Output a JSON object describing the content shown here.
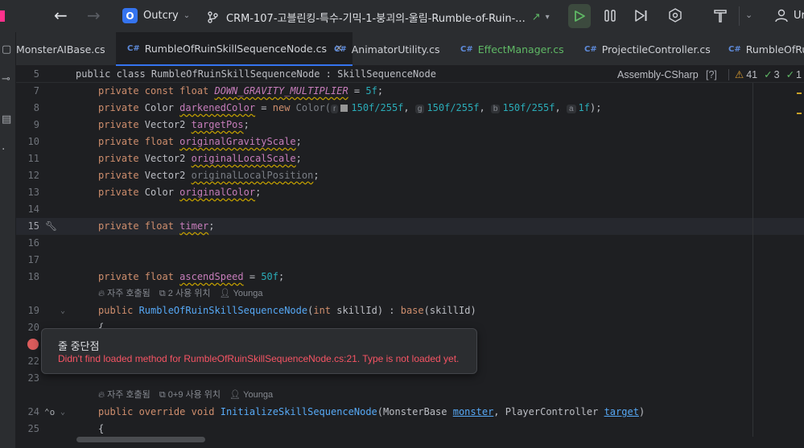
{
  "titlebar": {
    "project_initial": "O",
    "project_name": "Outcry",
    "branch": "CRM-107-고블린킹-특수-기믹-1-붕괴의-울림-Rumble-of-Ruin-...",
    "branch_arrow": "↗",
    "branch_more": "▾",
    "account_initial": "Ur"
  },
  "tabs": [
    {
      "label": "MonsterAIBase.cs",
      "badge": ""
    },
    {
      "label": "RumbleOfRuinSkillSequenceNode.cs",
      "badge": "C#"
    },
    {
      "label": "AnimatorUtility.cs",
      "badge": "C#"
    },
    {
      "label": "EffectManager.cs",
      "badge": "C#"
    },
    {
      "label": "ProjectileController.cs",
      "badge": "C#"
    },
    {
      "label": "RumbleOfRu",
      "badge": "C#"
    }
  ],
  "header": {
    "line_number": "5",
    "sticky_code": "public class RumbleOfRuinSkillSequenceNode : SkillSequenceNode",
    "assembly": "Assembly-CSharp",
    "warnings": "41",
    "checks": "3",
    "extra": "1"
  },
  "lines": [
    {
      "n": "7"
    },
    {
      "n": "8"
    },
    {
      "n": "9"
    },
    {
      "n": "10"
    },
    {
      "n": "11"
    },
    {
      "n": "12"
    },
    {
      "n": "13"
    },
    {
      "n": "14"
    },
    {
      "n": "15"
    },
    {
      "n": "16"
    },
    {
      "n": "17"
    },
    {
      "n": "18"
    },
    {
      "n": "19"
    },
    {
      "n": "20"
    },
    {
      "n": "22"
    },
    {
      "n": "23"
    },
    {
      "n": "24"
    },
    {
      "n": "25"
    }
  ],
  "code": {
    "l7": {
      "kw": "private const float ",
      "name": "DOWN_GRAVITY_MULTIPLIER",
      "rest": " = ",
      "val": "5f",
      "end": ";"
    },
    "l8": {
      "kw": "private",
      "type": " Color ",
      "name": "darkenedColor",
      "eq": " = ",
      "new": "new",
      "ctor": " Color(",
      "h_r": "r",
      "v_r": "150f/255f",
      "h_g": "g",
      "v_g": "150f/255f",
      "h_b": "b",
      "v_b": "150f/255f",
      "h_a": "a",
      "v_a": "1f",
      "end": ");"
    },
    "l9": {
      "kw": "private",
      "type": " Vector2 ",
      "name": "targetPos",
      "end": ";"
    },
    "l10": {
      "kw": "private float ",
      "name": "originalGravityScale",
      "end": ";"
    },
    "l11": {
      "kw": "private",
      "type": " Vector2 ",
      "name": "originalLocalScale",
      "end": ";"
    },
    "l12": {
      "kw": "private",
      "type": " Vector2 ",
      "name": "originalLocalPosition",
      "end": ";"
    },
    "l13": {
      "kw": "private",
      "type": " Color ",
      "name": "originalColor",
      "end": ";"
    },
    "l15": {
      "kw": "private float ",
      "name": "timer",
      "end": ";"
    },
    "l18": {
      "kw": "private float ",
      "name": "ascendSpeed",
      "eq": " = ",
      "val": "50f",
      "end": ";"
    },
    "l19": {
      "kw": "public",
      "name": " RumbleOfRuinSkillSequenceNode",
      "p1": "(",
      "ptype": "int",
      "pname": " skillId",
      "mid": ") : ",
      "base": "base",
      "tail": "(skillId)"
    },
    "l20": {
      "text": "{"
    },
    "l24": {
      "kw": "public override void ",
      "name": "InitializeSkillSequenceNode",
      "p1": "(MonsterBase ",
      "arg1": "monster",
      "comma": ", PlayerController ",
      "arg2": "target",
      "end": ")"
    },
    "l25": {
      "text": "{"
    }
  },
  "inlays": {
    "usage1": {
      "freq": "자주 호출됨",
      "uses": "2 사용 위치",
      "author": "Younga"
    },
    "usage2": {
      "freq": "자주 호출됨",
      "uses": "0+9 사용 위치",
      "author": "Younga"
    }
  },
  "popup": {
    "title": "줄 중단점",
    "message": "Didn't find loaded method for RumbleOfRuinSkillSequenceNode.cs:21. Type is not loaded yet."
  },
  "colors": {
    "accent": "#3574f0",
    "breakpoint": "#db5c5c",
    "error_text": "#f75464",
    "run": "#5fb865"
  }
}
